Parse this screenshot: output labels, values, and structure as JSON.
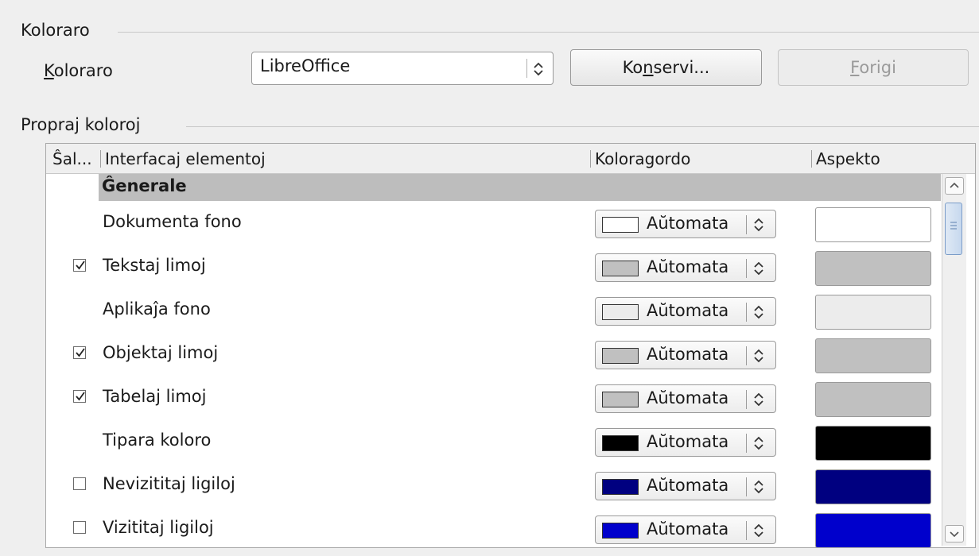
{
  "scheme_section": {
    "title": "Koloraro",
    "label": "Koloraro",
    "selected": "LibreOffice",
    "save_button": "Konservi...",
    "delete_button": "Forigi"
  },
  "custom_section": {
    "title": "Propraj koloroj"
  },
  "table": {
    "headers": {
      "toggle": "Ŝal...",
      "element": "Interfacaj elementoj",
      "color": "Koloragordo",
      "preview": "Aspekto"
    },
    "group": "Ĝenerale",
    "rows": [
      {
        "name": "Dokumenta fono",
        "has_checkbox": false,
        "checked": false,
        "color_label": "Aŭtomata",
        "color": "#ffffff"
      },
      {
        "name": "Tekstaj limoj",
        "has_checkbox": true,
        "checked": true,
        "color_label": "Aŭtomata",
        "color": "#c0c0c0"
      },
      {
        "name": "Aplikaĵa fono",
        "has_checkbox": false,
        "checked": false,
        "color_label": "Aŭtomata",
        "color": "#ececec"
      },
      {
        "name": "Objektaj limoj",
        "has_checkbox": true,
        "checked": true,
        "color_label": "Aŭtomata",
        "color": "#c0c0c0"
      },
      {
        "name": "Tabelaj limoj",
        "has_checkbox": true,
        "checked": true,
        "color_label": "Aŭtomata",
        "color": "#c0c0c0"
      },
      {
        "name": "Tipara koloro",
        "has_checkbox": false,
        "checked": false,
        "color_label": "Aŭtomata",
        "color": "#000000"
      },
      {
        "name": "Nevizititaj ligiloj",
        "has_checkbox": true,
        "checked": false,
        "color_label": "Aŭtomata",
        "color": "#000080"
      },
      {
        "name": "Vizititaj ligiloj",
        "has_checkbox": true,
        "checked": false,
        "color_label": "Aŭtomata",
        "color": "#0000cc"
      }
    ]
  },
  "colors": {
    "group_row": "#bdbdbd",
    "scroll_thumb": "#c6d8ee"
  }
}
